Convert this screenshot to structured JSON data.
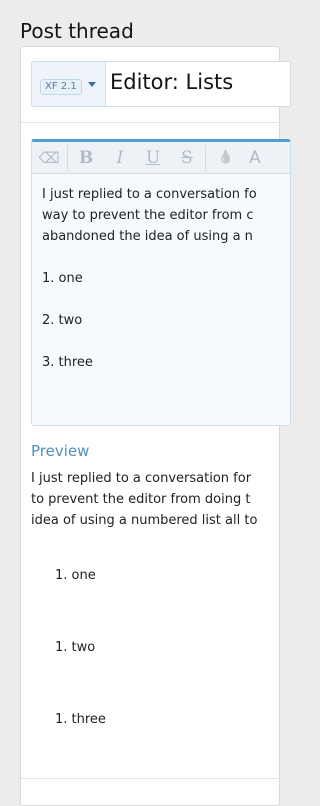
{
  "page": {
    "title": "Post thread"
  },
  "thread": {
    "prefix": "XF 2.1",
    "title_value": "Editor: Lists"
  },
  "toolbar": {
    "buttons": [
      {
        "icon": "eraser-icon",
        "glyph": "⌫"
      },
      {
        "icon": "bold-icon",
        "glyph": "B"
      },
      {
        "icon": "italic-icon",
        "glyph": "I"
      },
      {
        "icon": "underline-icon",
        "glyph": "U"
      },
      {
        "icon": "strikethrough-icon",
        "glyph": "S"
      },
      {
        "icon": "color-drop-icon",
        "glyph": "💧"
      }
    ]
  },
  "editor": {
    "lines": [
      "I just replied to a conversation fo",
      "way to prevent the editor from c",
      "abandoned the idea of using a n"
    ],
    "list": [
      "1. one",
      "2. two",
      "3. three"
    ]
  },
  "preview": {
    "label": "Preview",
    "lines": [
      "I just replied to a conversation for",
      "to prevent the editor from doing t",
      "idea of using a numbered list all to"
    ],
    "list": [
      "1. one",
      "1. two",
      "1. three"
    ]
  },
  "colors": {
    "accent": "#4f9fd6",
    "background": "#ececec",
    "panel": "#ffffff"
  }
}
